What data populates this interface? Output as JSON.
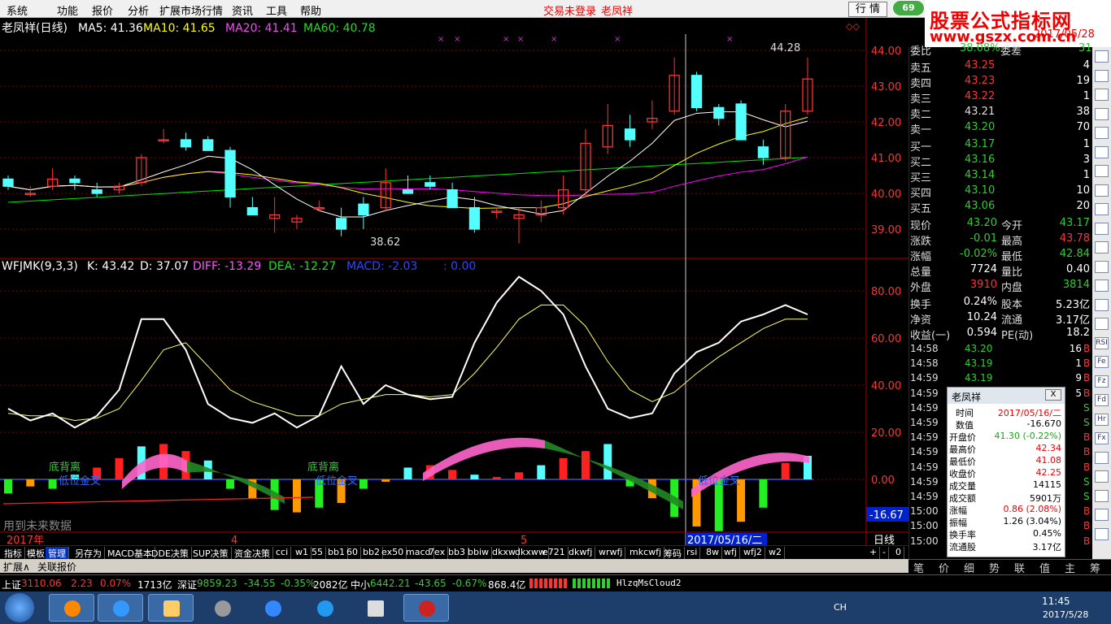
{
  "menu": {
    "items": [
      "系统",
      "功能",
      "报价",
      "分析",
      "扩展市场行情",
      "资讯",
      "工具",
      "帮助"
    ],
    "status_login": "交易未登录",
    "status_stock": "老凤祥",
    "hq_button": "行 情",
    "circle_value": "69"
  },
  "brand": {
    "line1": "股票公式指标网",
    "line2": "www.gszx.com.cn",
    "date": "2017/05/28"
  },
  "main_chart": {
    "title": "老凤祥(日线)",
    "ma5": "MA5: 41.36",
    "ma10": "MA10: 41.65",
    "ma20": "MA20: 41.41",
    "ma60": "MA60: 40.78",
    "high_label": "44.28",
    "low_label": "38.62",
    "y_ticks": [
      "44.00",
      "43.00",
      "42.00",
      "41.00",
      "40.00",
      "39.00"
    ]
  },
  "chart_data": {
    "type": "candlestick",
    "dates": [
      "2017-04-05",
      "2017-04-06",
      "2017-04-07",
      "2017-04-10",
      "2017-04-11",
      "2017-04-12",
      "2017-04-13",
      "2017-04-14",
      "2017-04-17",
      "2017-04-18",
      "2017-04-19",
      "2017-04-20",
      "2017-04-21",
      "2017-04-24",
      "2017-04-25",
      "2017-04-26",
      "2017-04-27",
      "2017-04-28",
      "2017-05-02",
      "2017-05-03",
      "2017-05-04",
      "2017-05-05",
      "2017-05-08",
      "2017-05-09",
      "2017-05-10",
      "2017-05-11",
      "2017-05-12",
      "2017-05-15",
      "2017-05-16",
      "2017-05-17",
      "2017-05-18",
      "2017-05-19",
      "2017-05-22",
      "2017-05-23",
      "2017-05-24",
      "2017-05-25",
      "2017-05-26"
    ],
    "ohlc": [
      [
        40.4,
        40.5,
        40.1,
        40.2
      ],
      [
        40.0,
        40.2,
        39.9,
        40.0
      ],
      [
        40.2,
        40.7,
        40.1,
        40.4
      ],
      [
        40.4,
        40.5,
        40.1,
        40.3
      ],
      [
        40.1,
        40.3,
        39.9,
        40.0
      ],
      [
        40.1,
        40.3,
        40.0,
        40.2
      ],
      [
        40.3,
        41.1,
        40.2,
        41.0
      ],
      [
        41.5,
        41.8,
        41.4,
        41.5
      ],
      [
        41.5,
        41.7,
        41.2,
        41.3
      ],
      [
        41.5,
        41.6,
        41.2,
        41.2
      ],
      [
        41.2,
        41.3,
        39.6,
        39.9
      ],
      [
        39.6,
        39.9,
        39.4,
        39.4
      ],
      [
        39.3,
        39.9,
        38.9,
        39.4
      ],
      [
        39.2,
        39.4,
        39.0,
        39.3
      ],
      [
        39.6,
        39.8,
        39.5,
        39.6
      ],
      [
        39.3,
        39.6,
        38.8,
        39.0
      ],
      [
        39.7,
        39.9,
        39.0,
        39.4
      ],
      [
        39.6,
        40.7,
        39.5,
        40.3
      ],
      [
        40.1,
        40.5,
        40.0,
        40.0
      ],
      [
        40.3,
        40.5,
        40.1,
        40.2
      ],
      [
        40.1,
        40.3,
        39.6,
        39.6
      ],
      [
        39.6,
        39.9,
        38.9,
        39.0
      ],
      [
        39.5,
        39.6,
        39.3,
        39.5
      ],
      [
        39.3,
        39.6,
        38.6,
        39.4
      ],
      [
        39.4,
        39.8,
        39.2,
        39.6
      ],
      [
        39.6,
        40.5,
        39.4,
        40.1
      ],
      [
        40.1,
        41.8,
        39.9,
        41.4
      ],
      [
        41.3,
        42.5,
        41.1,
        41.9
      ],
      [
        41.8,
        42.2,
        41.3,
        41.5
      ],
      [
        42.0,
        42.6,
        41.8,
        42.1
      ],
      [
        42.3,
        43.8,
        42.2,
        43.3
      ],
      [
        43.3,
        43.4,
        42.3,
        42.4
      ],
      [
        42.4,
        42.5,
        41.9,
        42.1
      ],
      [
        42.5,
        42.6,
        41.5,
        41.5
      ],
      [
        41.3,
        41.5,
        40.8,
        41.0
      ],
      [
        41.0,
        42.5,
        40.9,
        42.3
      ],
      [
        42.3,
        43.8,
        42.2,
        43.2
      ]
    ]
  },
  "sub_chart": {
    "title": "WFJMK(9,3,3)",
    "k": "K: 43.42",
    "d": "D: 37.07",
    "diff": "DIFF: -13.29",
    "dea": "DEA: -12.27",
    "macd": "MACD: -2.03",
    "last": ": 0.00",
    "y_ticks": [
      "80.00",
      "60.00",
      "40.00",
      "20.00",
      "0.00"
    ],
    "cur_value": "-16.67",
    "label_deviation": "底背离",
    "label_golden": "低位金叉",
    "future_text": "用到未来数据"
  },
  "x_axis": {
    "left": "2017年",
    "m4": "4",
    "m5": "5",
    "cursor_date": "2017/05/16/二",
    "period": "日线"
  },
  "quote": {
    "wb_label": "委比",
    "wb_value": "38.08%",
    "wc_label": "委差",
    "wc_value": "31",
    "asks": [
      {
        "label": "卖五",
        "price": "43.25",
        "vol": "4"
      },
      {
        "label": "卖四",
        "price": "43.23",
        "vol": "19"
      },
      {
        "label": "卖三",
        "price": "43.22",
        "vol": "1"
      },
      {
        "label": "卖二",
        "price": "43.21",
        "vol": "38"
      },
      {
        "label": "卖一",
        "price": "43.20",
        "vol": "70"
      }
    ],
    "bids": [
      {
        "label": "买一",
        "price": "43.17",
        "vol": "1"
      },
      {
        "label": "买二",
        "price": "43.16",
        "vol": "3"
      },
      {
        "label": "买三",
        "price": "43.14",
        "vol": "1"
      },
      {
        "label": "买四",
        "price": "43.10",
        "vol": "10"
      },
      {
        "label": "买五",
        "price": "43.06",
        "vol": "20"
      }
    ],
    "stats": [
      {
        "l1": "现价",
        "v1": "43.20",
        "l2": "今开",
        "v2": "43.17"
      },
      {
        "l1": "涨跌",
        "v1": "-0.01",
        "l2": "最高",
        "v2": "43.78"
      },
      {
        "l1": "涨幅",
        "v1": "-0.02%",
        "l2": "最低",
        "v2": "42.84"
      },
      {
        "l1": "总量",
        "v1": "7724",
        "l2": "量比",
        "v2": "0.40"
      },
      {
        "l1": "外盘",
        "v1": "3910",
        "l2": "内盘",
        "v2": "3814"
      },
      {
        "l1": "换手",
        "v1": "0.24%",
        "l2": "股本",
        "v2": "5.23亿"
      },
      {
        "l1": "净资",
        "v1": "10.24",
        "l2": "流通",
        "v2": "3.17亿"
      },
      {
        "l1": "收益(一)",
        "v1": "0.594",
        "l2": "PE(动)",
        "v2": "18.2"
      }
    ],
    "ticks": [
      {
        "t": "14:58",
        "p": "43.20",
        "v": "16",
        "s": "B"
      },
      {
        "t": "14:58",
        "p": "43.19",
        "v": "1",
        "s": "B"
      },
      {
        "t": "14:59",
        "p": "43.19",
        "v": "9",
        "s": "B"
      },
      {
        "t": "14:59",
        "p": "",
        "v": "5",
        "s": "B"
      },
      {
        "t": "14:59",
        "p": "",
        "v": "",
        "s": "S"
      },
      {
        "t": "14:59",
        "p": "",
        "v": "",
        "s": "S"
      },
      {
        "t": "14:59",
        "p": "",
        "v": "",
        "s": "B"
      },
      {
        "t": "14:59",
        "p": "",
        "v": "",
        "s": "B"
      },
      {
        "t": "14:59",
        "p": "",
        "v": "",
        "s": "B"
      },
      {
        "t": "14:59",
        "p": "",
        "v": "",
        "s": "S"
      },
      {
        "t": "14:59",
        "p": "",
        "v": "",
        "s": "S"
      },
      {
        "t": "15:00",
        "p": "",
        "v": "",
        "s": "B"
      },
      {
        "t": "15:00",
        "p": "",
        "v": "",
        "s": "B"
      },
      {
        "t": "15:00",
        "p": "",
        "v": "",
        "s": "B"
      }
    ]
  },
  "popup": {
    "title": "老凤祥",
    "close": "X",
    "rows": [
      {
        "k": "时间",
        "v": "2017/05/16/二"
      },
      {
        "k": "数值",
        "v": "-16.670"
      },
      {
        "k": "开盘价",
        "v": "41.30 (-0.22%)"
      },
      {
        "k": "最高价",
        "v": "42.34"
      },
      {
        "k": "最低价",
        "v": "41.08"
      },
      {
        "k": "收盘价",
        "v": "42.25"
      },
      {
        "k": "成交量",
        "v": "14115"
      },
      {
        "k": "成交额",
        "v": "5901万"
      },
      {
        "k": "涨幅",
        "v": "0.86 (2.08%)"
      },
      {
        "k": "振幅",
        "v": "1.26 (3.04%)"
      },
      {
        "k": "换手率",
        "v": "0.45%"
      },
      {
        "k": "流通股",
        "v": "3.17亿"
      }
    ]
  },
  "tabs": [
    "指标",
    "模板",
    "管理",
    "另存为",
    "MACD基本",
    "DDE决策",
    "SUP决策",
    "资金决策",
    "cci",
    "w1",
    "55",
    "bb1",
    "60",
    "bb2",
    "ex50",
    "macd",
    "7ex",
    "bb3",
    "bbiw",
    "dkxw",
    "dkxww",
    "e721",
    "dkwfj",
    "wrwfj",
    "mkcwfj",
    "筹码",
    "rsi",
    "8w",
    "wfj",
    "wfj2",
    "w2",
    "+",
    "-",
    "0"
  ],
  "tabs2": [
    "扩展∧",
    "关联报价"
  ],
  "rtabs": [
    "笔",
    "价",
    "细",
    "势",
    "联",
    "值",
    "主",
    "筹"
  ],
  "status": {
    "sh_label": "上证",
    "sh_idx": "3110.06",
    "sh_chg": "2.23",
    "sh_pct": "0.07%",
    "sh_amt": "1713亿",
    "sz_label": "深证",
    "sz_idx": "9859.23",
    "sz_chg": "-34.55",
    "sz_pct": "-0.35%",
    "sz_amt": "2082亿",
    "zx_label": "中小",
    "zx_idx": "6442.21",
    "zx_chg": "-43.65",
    "zx_pct": "-0.67%",
    "zx_amt": "868.4亿",
    "server": "HlzqMsCloud2"
  },
  "tray": {
    "lang": "CH",
    "time": "11:45",
    "date": "2017/5/28"
  },
  "toolstrip": [
    "RSI",
    "Fe",
    "Fz",
    "Fd",
    "Hr",
    "Fx"
  ],
  "colors": {
    "up": "#ff3232",
    "down": "#54ffff",
    "ma5": "#ffffff",
    "ma10": "#ffff00",
    "ma20": "#ff00ff",
    "ma60": "#00e600",
    "grid": "#800000"
  }
}
